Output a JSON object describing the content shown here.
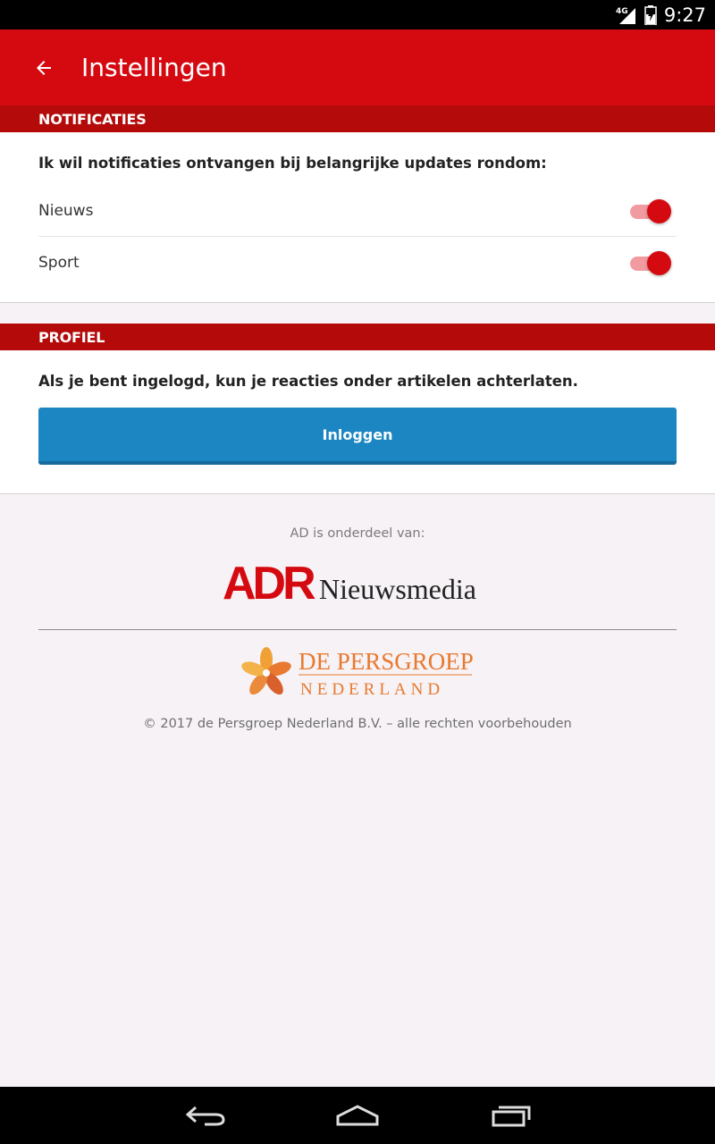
{
  "status_bar": {
    "network": "4G",
    "time": "9:27"
  },
  "app_bar": {
    "title": "Instellingen",
    "back_icon": "arrow-left-icon"
  },
  "notifications": {
    "header": "NOTIFICATIES",
    "intro": "Ik wil notificaties ontvangen bij belangrijke updates rondom:",
    "items": [
      {
        "label": "Nieuws",
        "enabled": true
      },
      {
        "label": "Sport",
        "enabled": true
      }
    ]
  },
  "profile": {
    "header": "PROFIEL",
    "intro": "Als je bent ingelogd, kun je reacties onder artikelen achterlaten.",
    "login_label": "Inloggen"
  },
  "footer": {
    "caption": "AD is onderdeel van:",
    "adr_logo": {
      "mark": "ADR",
      "text": "Nieuwsmedia"
    },
    "persgroep_logo": {
      "line1": "DE PERSGROEP",
      "line2": "NEDERLAND"
    },
    "copyright": "© 2017 de Persgroep Nederland B.V. – alle rechten voorbehouden"
  },
  "nav_bar": {
    "icons": [
      "back-icon",
      "home-icon",
      "recent-apps-icon"
    ]
  },
  "colors": {
    "brand_red": "#d50a11",
    "section_red": "#b40a0a",
    "button_blue": "#1c86c2",
    "logo_orange": "#e8792f"
  }
}
